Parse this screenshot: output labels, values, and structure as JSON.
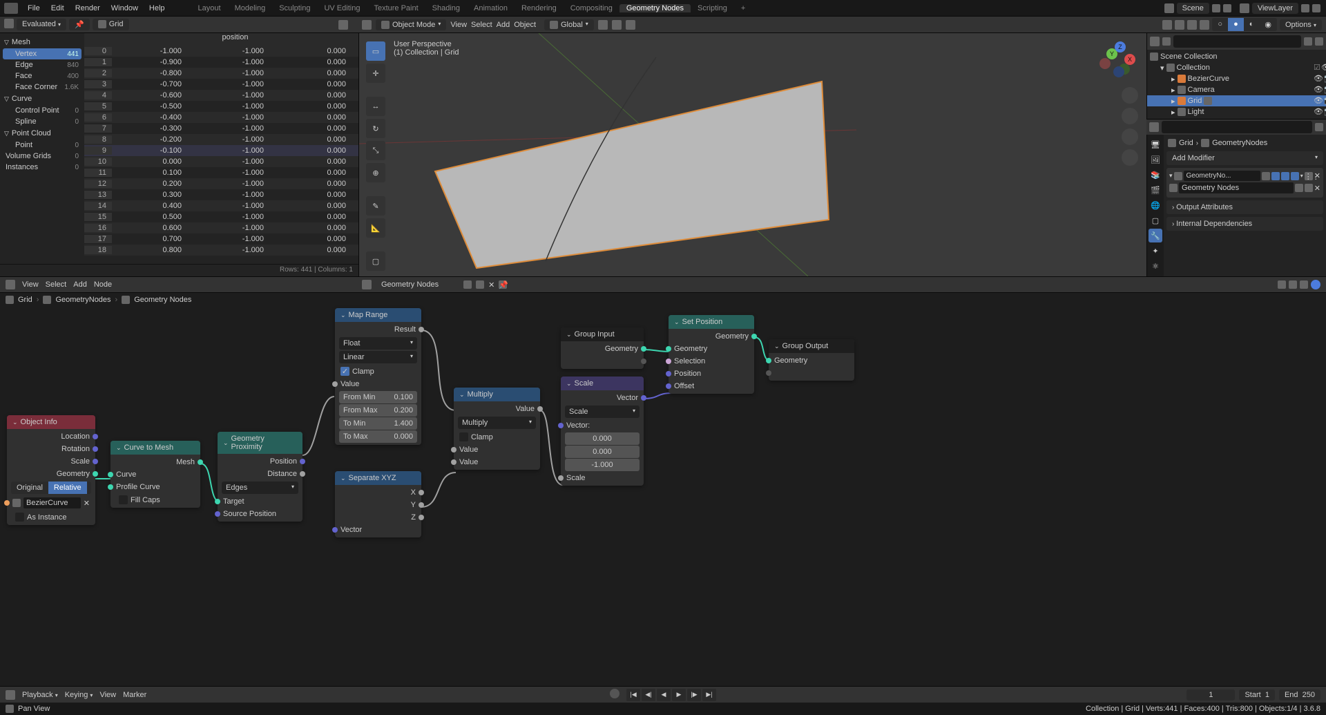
{
  "topmenu": {
    "items": [
      "File",
      "Edit",
      "Render",
      "Window",
      "Help"
    ]
  },
  "workspaces": {
    "items": [
      "Layout",
      "Modeling",
      "Sculpting",
      "UV Editing",
      "Texture Paint",
      "Shading",
      "Animation",
      "Rendering",
      "Compositing",
      "Geometry Nodes",
      "Scripting"
    ],
    "active": "Geometry Nodes"
  },
  "scene": {
    "label": "Scene",
    "viewlayer": "ViewLayer"
  },
  "spreadsheet": {
    "mode": "Evaluated",
    "object": "Grid",
    "tree": {
      "mesh": "Mesh",
      "vertex": {
        "label": "Vertex",
        "count": "441"
      },
      "edge": {
        "label": "Edge",
        "count": "840"
      },
      "face": {
        "label": "Face",
        "count": "400"
      },
      "corner": {
        "label": "Face Corner",
        "count": "1.6K"
      },
      "curve": "Curve",
      "ctrlpt": {
        "label": "Control Point",
        "count": "0"
      },
      "spline": {
        "label": "Spline",
        "count": "0"
      },
      "ptcloud": "Point Cloud",
      "point": {
        "label": "Point",
        "count": "0"
      },
      "volgrids": {
        "label": "Volume Grids",
        "count": "0"
      },
      "inst": {
        "label": "Instances",
        "count": "0"
      }
    },
    "header": "position",
    "rows": [
      {
        "i": "0",
        "x": "-1.000",
        "y": "-1.000",
        "z": "0.000"
      },
      {
        "i": "1",
        "x": "-0.900",
        "y": "-1.000",
        "z": "0.000"
      },
      {
        "i": "2",
        "x": "-0.800",
        "y": "-1.000",
        "z": "0.000"
      },
      {
        "i": "3",
        "x": "-0.700",
        "y": "-1.000",
        "z": "0.000"
      },
      {
        "i": "4",
        "x": "-0.600",
        "y": "-1.000",
        "z": "0.000"
      },
      {
        "i": "5",
        "x": "-0.500",
        "y": "-1.000",
        "z": "0.000"
      },
      {
        "i": "6",
        "x": "-0.400",
        "y": "-1.000",
        "z": "0.000"
      },
      {
        "i": "7",
        "x": "-0.300",
        "y": "-1.000",
        "z": "0.000"
      },
      {
        "i": "8",
        "x": "-0.200",
        "y": "-1.000",
        "z": "0.000"
      },
      {
        "i": "9",
        "x": "-0.100",
        "y": "-1.000",
        "z": "0.000"
      },
      {
        "i": "10",
        "x": "0.000",
        "y": "-1.000",
        "z": "0.000"
      },
      {
        "i": "11",
        "x": "0.100",
        "y": "-1.000",
        "z": "0.000"
      },
      {
        "i": "12",
        "x": "0.200",
        "y": "-1.000",
        "z": "0.000"
      },
      {
        "i": "13",
        "x": "0.300",
        "y": "-1.000",
        "z": "0.000"
      },
      {
        "i": "14",
        "x": "0.400",
        "y": "-1.000",
        "z": "0.000"
      },
      {
        "i": "15",
        "x": "0.500",
        "y": "-1.000",
        "z": "0.000"
      },
      {
        "i": "16",
        "x": "0.600",
        "y": "-1.000",
        "z": "0.000"
      },
      {
        "i": "17",
        "x": "0.700",
        "y": "-1.000",
        "z": "0.000"
      },
      {
        "i": "18",
        "x": "0.800",
        "y": "-1.000",
        "z": "0.000"
      }
    ],
    "footer": "Rows: 441  |  Columns: 1"
  },
  "v3d": {
    "header": {
      "mode": "Object Mode",
      "view": "View",
      "select": "Select",
      "add": "Add",
      "object": "Object",
      "orient": "Global"
    },
    "perspective": "User Perspective",
    "info": "(1) Collection | Grid",
    "options": "Options",
    "axes": {
      "x": "X",
      "y": "Y",
      "z": "Z"
    }
  },
  "outliner": {
    "root": "Scene Collection",
    "coll": "Collection",
    "items": [
      {
        "name": "BezierCurve",
        "icon": "curve"
      },
      {
        "name": "Camera",
        "icon": "camera"
      },
      {
        "name": "Grid",
        "icon": "mesh",
        "sel": true
      },
      {
        "name": "Light",
        "icon": "light"
      }
    ]
  },
  "nodemenu": {
    "view": "View",
    "select": "Select",
    "add": "Add",
    "node": "Node",
    "gn": "Geometry Nodes"
  },
  "crumb": {
    "obj": "Grid",
    "mod": "GeometryNodes",
    "tree": "Geometry Nodes"
  },
  "nodes": {
    "objinfo": {
      "title": "Object Info",
      "loc": "Location",
      "rot": "Rotation",
      "scale": "Scale",
      "geom": "Geometry",
      "orig": "Original",
      "rel": "Relative",
      "field": "BezierCurve",
      "asinst": "As Instance"
    },
    "ctm": {
      "title": "Curve to Mesh",
      "mesh": "Mesh",
      "curve": "Curve",
      "profile": "Profile Curve",
      "fillcaps": "Fill Caps"
    },
    "gprox": {
      "title": "Geometry Proximity",
      "pos": "Position",
      "dist": "Distance",
      "mode": "Edges",
      "target": "Target",
      "srcpos": "Source Position"
    },
    "maprange": {
      "title": "Map Range",
      "result": "Result",
      "float": "Float",
      "linear": "Linear",
      "clamp": "Clamp",
      "value": "Value",
      "fmin_l": "From Min",
      "fmin_v": "0.100",
      "fmax_l": "From Max",
      "fmax_v": "0.200",
      "tmin_l": "To Min",
      "tmin_v": "1.400",
      "tmax_l": "To Max",
      "tmax_v": "0.000"
    },
    "sepxyz": {
      "title": "Separate XYZ",
      "x": "X",
      "y": "Y",
      "z": "Z",
      "vec": "Vector"
    },
    "multiply": {
      "title": "Multiply",
      "value": "Value",
      "op": "Multiply",
      "clamp": "Clamp",
      "v2": "Value",
      "v3": "Value"
    },
    "groupin": {
      "title": "Group Input",
      "geom": "Geometry"
    },
    "scale": {
      "title": "Scale",
      "vec": "Vector",
      "op": "Scale",
      "vecl": "Vector:",
      "x": "0.000",
      "y": "0.000",
      "z": "-1.000",
      "scalel": "Scale"
    },
    "setpos": {
      "title": "Set Position",
      "geomout": "Geometry",
      "geomin": "Geometry",
      "sel": "Selection",
      "pos": "Position",
      "off": "Offset"
    },
    "groupout": {
      "title": "Group Output",
      "geom": "Geometry"
    }
  },
  "props": {
    "bc_obj": "Grid",
    "bc_mod": "GeometryNodes",
    "addmod": "Add Modifier",
    "modname": "GeometryNo...",
    "treename": "Geometry Nodes",
    "outattr": "Output Attributes",
    "intdep": "Internal Dependencies"
  },
  "timeline": {
    "playback": "Playback",
    "keying": "Keying",
    "view": "View",
    "marker": "Marker",
    "frame": "1",
    "start_l": "Start",
    "start_v": "1",
    "end_l": "End",
    "end_v": "250"
  },
  "status": {
    "left": "Pan View",
    "right": "Collection | Grid | Verts:441 | Faces:400 | Tris:800 | Objects:1/4 | 3.6.8"
  }
}
